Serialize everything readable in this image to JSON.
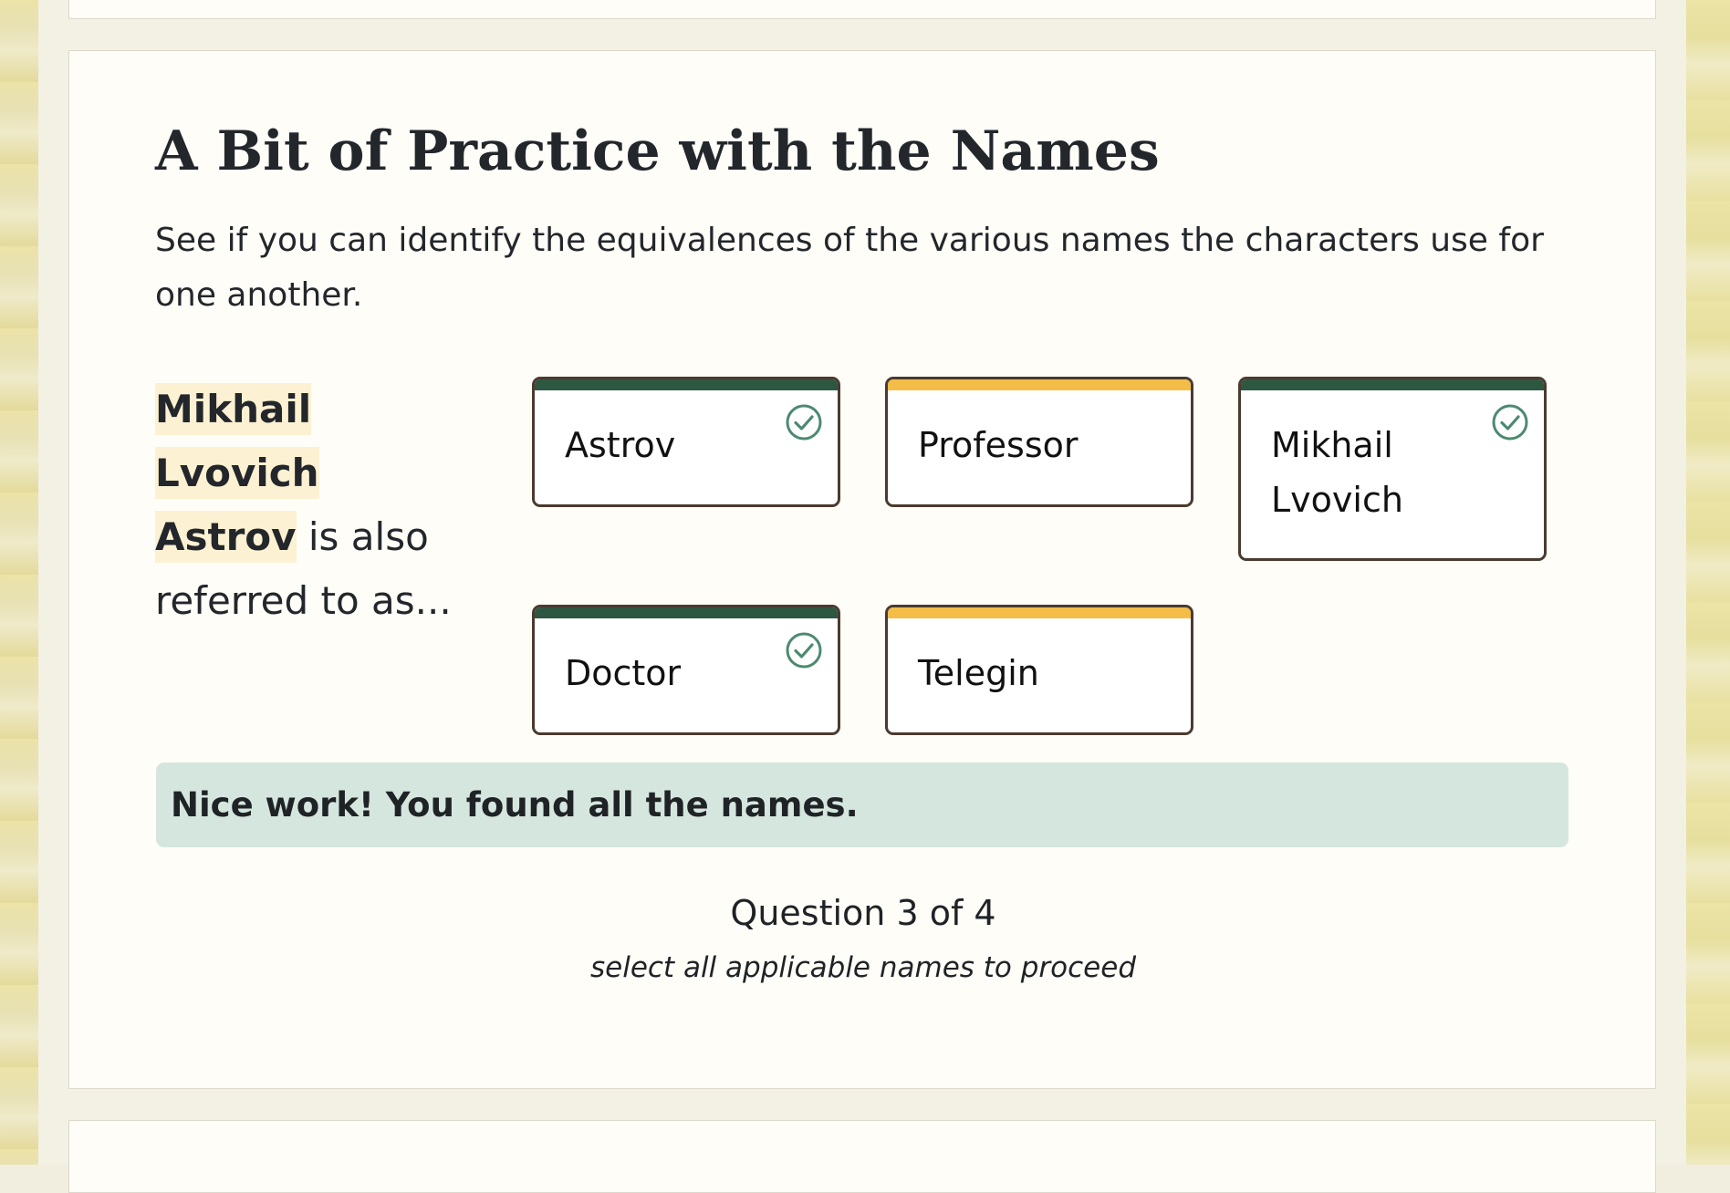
{
  "section": {
    "title": "A Bit of Practice with the Names",
    "intro": "See if you can identify the equivalences of the various names the characters use for one another."
  },
  "question": {
    "name_part1": "Mikhail Lvovich",
    "name_part2": "Astrov",
    "prompt_suffix": " is also referred to as..."
  },
  "options": [
    {
      "label": "Astrov",
      "state": "selected"
    },
    {
      "label": "Professor",
      "state": "unselected"
    },
    {
      "label": "Mikhail Lvovich",
      "state": "selected"
    },
    {
      "label": "Doctor",
      "state": "selected"
    },
    {
      "label": "Telegin",
      "state": "unselected"
    }
  ],
  "feedback": "Nice work! You found all the names.",
  "progress": "Question 3 of 4",
  "hint": "select all applicable names to proceed",
  "colors": {
    "selected_bar": "#2e5741",
    "unselected_bar": "#f4bd48",
    "check": "#4c8a70",
    "feedback_bg": "#d5e6df",
    "highlight": "#fcf1d2"
  }
}
